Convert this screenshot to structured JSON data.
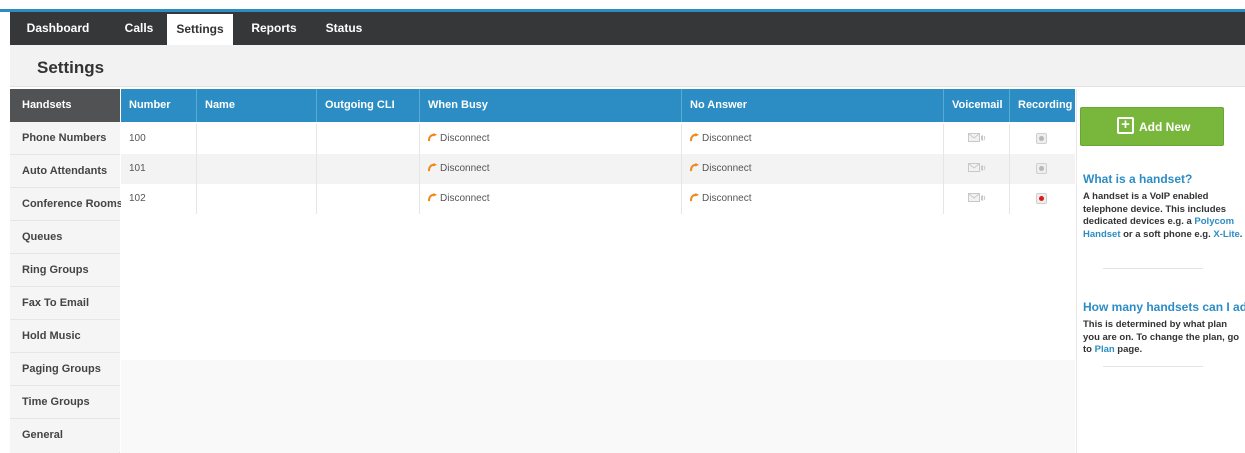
{
  "nav": {
    "tabs": [
      {
        "label": "Dashboard"
      },
      {
        "label": "Calls"
      },
      {
        "label": "Settings"
      },
      {
        "label": "Reports"
      },
      {
        "label": "Status"
      }
    ],
    "active": "Settings"
  },
  "page": {
    "title": "Settings"
  },
  "sidebar": {
    "items": [
      {
        "label": "Handsets"
      },
      {
        "label": "Phone Numbers"
      },
      {
        "label": "Auto Attendants"
      },
      {
        "label": "Conference Rooms"
      },
      {
        "label": "Queues"
      },
      {
        "label": "Ring Groups"
      },
      {
        "label": "Fax To Email"
      },
      {
        "label": "Hold Music"
      },
      {
        "label": "Paging Groups"
      },
      {
        "label": "Time Groups"
      },
      {
        "label": "General"
      }
    ],
    "active": "Handsets"
  },
  "table": {
    "columns": [
      "Number",
      "Name",
      "Outgoing CLI",
      "When Busy",
      "No Answer",
      "Voicemail",
      "Recording"
    ],
    "rows": [
      {
        "number": "100",
        "name": "",
        "outgoing_cli": "",
        "when_busy": "Disconnect",
        "no_answer": "Disconnect",
        "voicemail_icon": "voicemail-icon",
        "recording": "off"
      },
      {
        "number": "101",
        "name": "",
        "outgoing_cli": "",
        "when_busy": "Disconnect",
        "no_answer": "Disconnect",
        "voicemail_icon": "voicemail-icon",
        "recording": "off"
      },
      {
        "number": "102",
        "name": "",
        "outgoing_cli": "",
        "when_busy": "Disconnect",
        "no_answer": "Disconnect",
        "voicemail_icon": "voicemail-icon",
        "recording": "on"
      }
    ]
  },
  "rightpanel": {
    "add_button": "Add New",
    "help": [
      {
        "title": "What is a handset?",
        "text_parts": [
          {
            "text": "A handset is a VoIP enabled telephone device. This includes dedicated devices e.g. a "
          },
          {
            "text": "Polycom Handset",
            "link": true
          },
          {
            "text": " or a soft phone e.g. "
          },
          {
            "text": "X-Lite",
            "link": true
          },
          {
            "text": "."
          }
        ]
      },
      {
        "title": "How many handsets can I add?",
        "text_parts": [
          {
            "text": "This is determined by what plan you are on. To change the plan, go to "
          },
          {
            "text": "Plan",
            "link": true
          },
          {
            "text": " page."
          }
        ]
      }
    ]
  },
  "colors": {
    "accent_blue": "#2b8dc4",
    "nav_dark": "#353739",
    "add_green": "#79b73c",
    "forward_orange": "#f08a1c",
    "recording_red": "#e01818"
  }
}
